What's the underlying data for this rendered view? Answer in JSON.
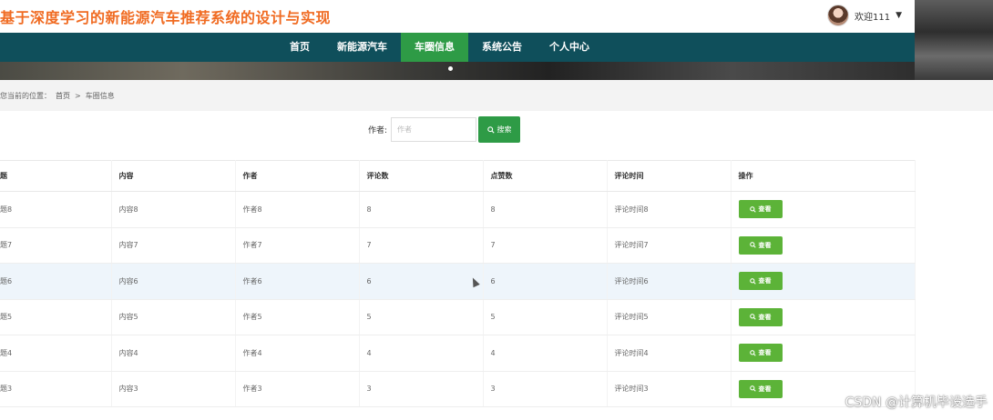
{
  "header": {
    "title": "基于深度学习的新能源汽车推荐系统的设计与实现",
    "welcome": "欢迎111"
  },
  "nav": {
    "items": [
      "首页",
      "新能源汽车",
      "车圈信息",
      "系统公告",
      "个人中心"
    ],
    "active_index": 2
  },
  "breadcrumb": {
    "prefix": "您当前的位置：",
    "home": "首页",
    "separator": ">",
    "current": "车圈信息"
  },
  "search": {
    "label": "作者:",
    "placeholder": "作者",
    "button": "搜索"
  },
  "table": {
    "headers": [
      "标题",
      "内容",
      "作者",
      "评论数",
      "点赞数",
      "评论时间",
      "操作"
    ],
    "visible_headers": [
      "题",
      "内容",
      "作者",
      "评论数",
      "点赞数",
      "评论时间",
      "操作"
    ],
    "rows": [
      [
        "题8",
        "内容8",
        "作者8",
        "8",
        "8",
        "评论时间8"
      ],
      [
        "题7",
        "内容7",
        "作者7",
        "7",
        "7",
        "评论时间7"
      ],
      [
        "题6",
        "内容6",
        "作者6",
        "6",
        "6",
        "评论时间6"
      ],
      [
        "题5",
        "内容5",
        "作者5",
        "5",
        "5",
        "评论时间5"
      ],
      [
        "题4",
        "内容4",
        "作者4",
        "4",
        "4",
        "评论时间4"
      ],
      [
        "题3",
        "内容3",
        "作者3",
        "3",
        "3",
        "评论时间3"
      ]
    ],
    "action_label": "查看",
    "highlight_row": 2
  },
  "watermark": "CSDN @计算机毕设选手",
  "colors": {
    "title": "#f06b22",
    "nav_bg": "#0f4f5b",
    "accent": "#2e9b46",
    "view_button": "#5cb338"
  },
  "icons": [
    "search-icon",
    "chevron-down-icon",
    "avatar"
  ]
}
